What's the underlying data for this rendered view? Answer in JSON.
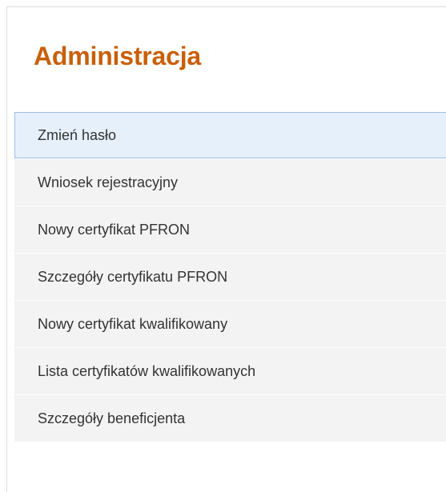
{
  "panel": {
    "title": "Administracja",
    "menu": [
      {
        "label": "Zmień hasło",
        "active": true
      },
      {
        "label": "Wniosek rejestracyjny",
        "active": false
      },
      {
        "label": "Nowy certyfikat PFRON",
        "active": false
      },
      {
        "label": "Szczegóły certyfikatu PFRON",
        "active": false
      },
      {
        "label": "Nowy certyfikat kwalifikowany",
        "active": false
      },
      {
        "label": "Lista certyfikatów kwalifikowanych",
        "active": false
      },
      {
        "label": "Szczegóły beneficjenta",
        "active": false
      }
    ]
  },
  "colors": {
    "title": "#c8600a",
    "item_background": "#f3f3f3",
    "active_background": "#e6f0fb",
    "active_border": "#9ec0e3",
    "item_text": "#333333"
  }
}
